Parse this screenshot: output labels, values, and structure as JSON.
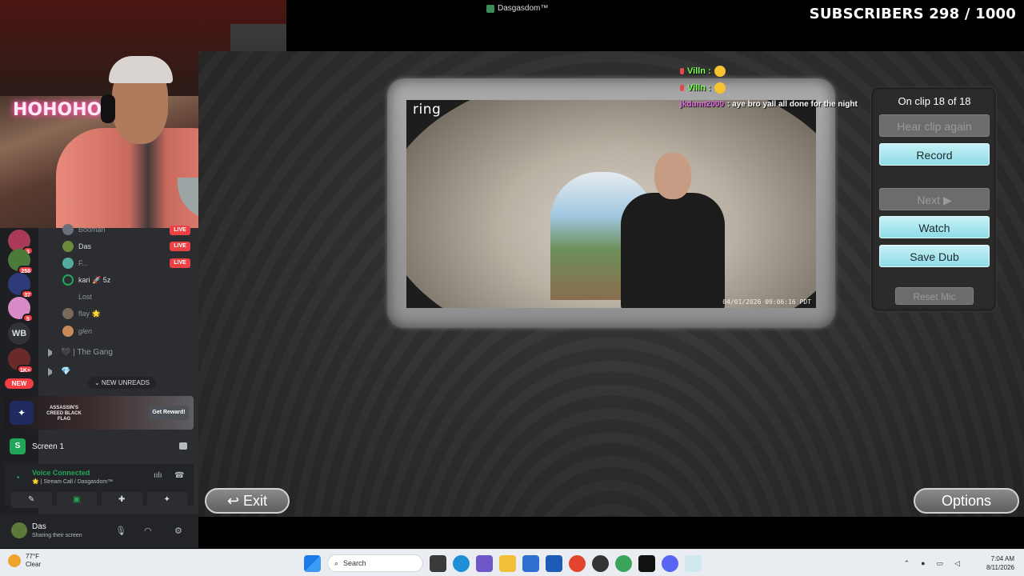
{
  "window": {
    "title": "Dasgasdom™"
  },
  "overlay": {
    "subscribers": "SUBSCRIBERS 298 / 1000"
  },
  "webcam": {
    "neon_text": "HOHOHO"
  },
  "discord": {
    "servers": [
      {
        "badge": "3"
      },
      {
        "badge": "258"
      },
      {
        "badge": "37"
      },
      {
        "badge": "5"
      },
      {
        "label": "WB"
      },
      {
        "badge": "1K+"
      }
    ],
    "new_pill": "NEW",
    "voice_members": [
      {
        "name": "Booman",
        "live": "LIVE"
      },
      {
        "name": "Das",
        "live": "LIVE"
      },
      {
        "name": "F...",
        "live": "LIVE"
      },
      {
        "name": "kari 🚀 5z",
        "live": ""
      },
      {
        "name": "Lost",
        "live": ""
      },
      {
        "name": "flay 🌟",
        "live": ""
      },
      {
        "name": "glen",
        "live": ""
      }
    ],
    "channels": [
      {
        "name": "🖤 | The Gang"
      },
      {
        "name": "💎"
      }
    ],
    "new_unreads": "⌄  NEW UNREADS",
    "promo": {
      "game": "ASSASSIN'S CREED BLACK FLAG",
      "cta": "Get Reward!"
    },
    "screen_share": {
      "name": "Screen 1"
    },
    "voice": {
      "status": "Voice Connected",
      "channel": "🌟 | Stream Call / Dasgasdom™"
    },
    "user": {
      "name": "Das",
      "status": "Sharing their screen"
    }
  },
  "game": {
    "ring_logo": "ring",
    "timestamp": "04/01/2026 09:06:16 PDT",
    "chat": [
      {
        "user": "Villn :",
        "message": "",
        "color": "#7cff4e"
      },
      {
        "user": "Villn :",
        "message": "",
        "color": "#7cff4e"
      },
      {
        "user": "jkdunn2000",
        "message": ": aye bro yall all done for the night",
        "color": "#e36be0"
      }
    ],
    "panel": {
      "clip_status": "On clip 18 of 18",
      "hear_again": "Hear clip again",
      "record": "Record",
      "next": "Next ▶",
      "watch": "Watch",
      "save_dub": "Save Dub",
      "reset_mic": "Reset Mic"
    },
    "exit": "↩ Exit",
    "options": "Options"
  },
  "taskbar": {
    "weather": {
      "temp": "77°F",
      "condition": "Clear"
    },
    "search_placeholder": "Search",
    "time": "7:04 AM",
    "date": "8/11/2026"
  }
}
